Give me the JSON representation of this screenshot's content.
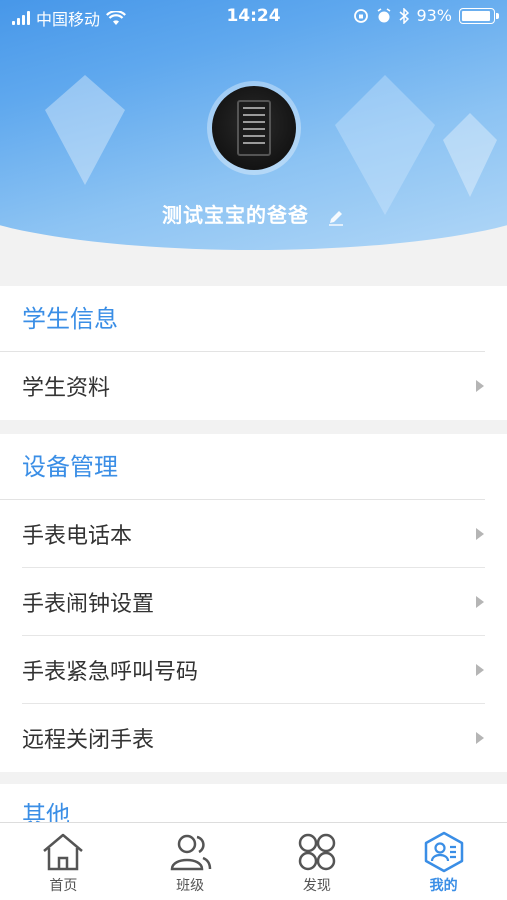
{
  "status_bar": {
    "carrier": "中国移动",
    "time": "14:24",
    "battery": "93%",
    "battery_level": 0.93
  },
  "profile": {
    "name": "测试宝宝的爸爸"
  },
  "sections": [
    {
      "title": "学生信息",
      "items": [
        "学生资料"
      ]
    },
    {
      "title": "设备管理",
      "items": [
        "手表电话本",
        "手表闹钟设置",
        "手表紧急呼叫号码",
        "远程关闭手表"
      ]
    },
    {
      "title": "其他",
      "items": []
    }
  ],
  "tabs": [
    {
      "label": "首页",
      "icon": "home-icon",
      "active": false
    },
    {
      "label": "班级",
      "icon": "class-icon",
      "active": false
    },
    {
      "label": "发现",
      "icon": "discover-icon",
      "active": false
    },
    {
      "label": "我的",
      "icon": "profile-icon",
      "active": true
    }
  ],
  "colors": {
    "accent": "#3a8ee6",
    "text": "#333333",
    "background": "#f2f2f2"
  }
}
